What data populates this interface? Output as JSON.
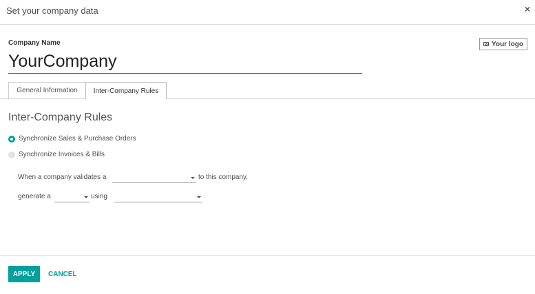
{
  "dialog": {
    "title": "Set your company data",
    "close_symbol": "×"
  },
  "company": {
    "label": "Company Name",
    "value": "YourCompany",
    "logo_button": "Your logo",
    "logo_icon": "camera-icon"
  },
  "tabs": [
    {
      "label": "General Information",
      "active": false
    },
    {
      "label": "Inter-Company Rules",
      "active": true
    }
  ],
  "rules": {
    "title": "Inter-Company Rules",
    "options": [
      {
        "label": "Synchronize Sales & Purchase Orders",
        "selected": true
      },
      {
        "label": "Synchronize Invoices & Bills",
        "selected": false
      }
    ],
    "line1": {
      "prefix": "When a company validates a",
      "value": "",
      "suffix": "to this company,"
    },
    "line2": {
      "prefix": "generate a",
      "value1": "",
      "middle": "using",
      "value2": ""
    }
  },
  "footer": {
    "apply": "APPLY",
    "cancel": "CANCEL"
  },
  "colors": {
    "accent": "#00a09d"
  }
}
